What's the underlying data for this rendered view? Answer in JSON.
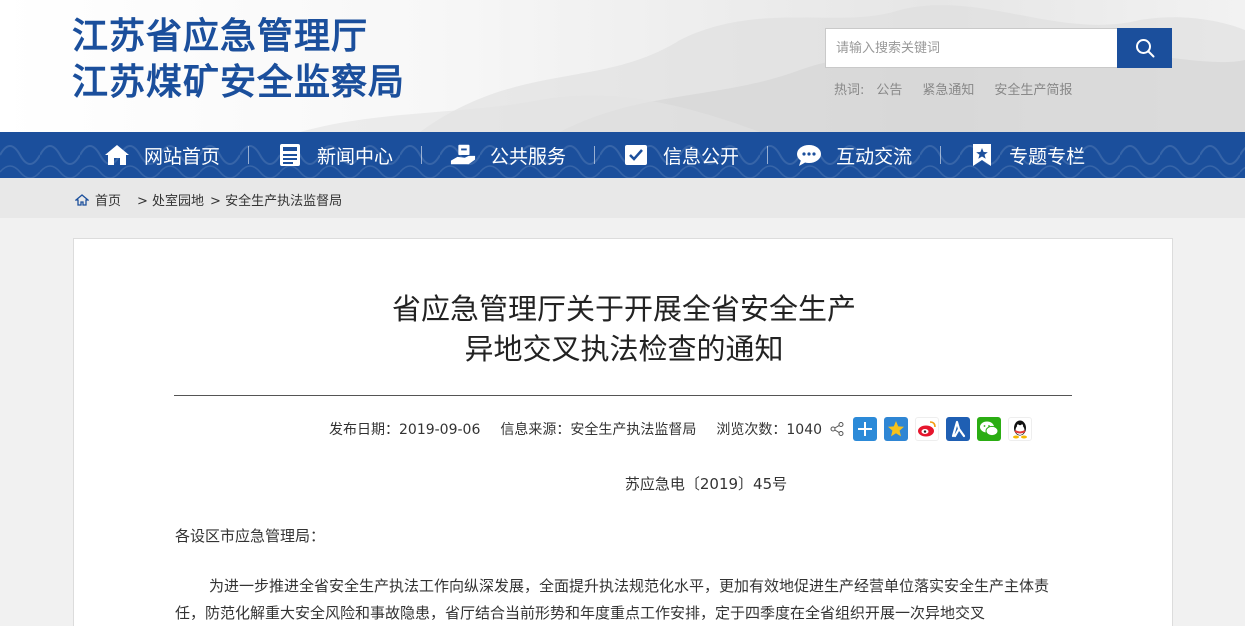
{
  "header": {
    "org_line1": "江苏省应急管理厅",
    "org_line2": "江苏煤矿安全监察局",
    "search_placeholder": "请输入搜索关键词",
    "hot_label": "热词:",
    "hot_words": [
      "公告",
      "紧急通知",
      "安全生产简报"
    ]
  },
  "nav": {
    "items": [
      {
        "label": "网站首页",
        "icon": "home-icon"
      },
      {
        "label": "新闻中心",
        "icon": "news-icon"
      },
      {
        "label": "公共服务",
        "icon": "service-icon"
      },
      {
        "label": "信息公开",
        "icon": "info-icon"
      },
      {
        "label": "互动交流",
        "icon": "chat-icon"
      },
      {
        "label": "专题专栏",
        "icon": "bookmark-icon"
      }
    ]
  },
  "breadcrumb": {
    "home": "首页",
    "items": [
      "> 处室园地",
      "> 安全生产执法监督局"
    ]
  },
  "article": {
    "title_line1": "省应急管理厅关于开展全省安全生产",
    "title_line2": "异地交叉执法检查的通知",
    "date": "发布日期：2019-09-06",
    "source": "信息来源：安全生产执法监督局",
    "views": "浏览次数：1040",
    "share_icons": [
      "more-share-icon",
      "qzone-icon",
      "weibo-icon",
      "renren-icon",
      "wechat-icon",
      "qq-icon"
    ],
    "doc_number": "苏应急电〔2019〕45号",
    "salutation": "各设区市应急管理局：",
    "paragraph": "为进一步推进全省安全生产执法工作向纵深发展，全面提升执法规范化水平，更加有效地促进生产经营单位落实安全生产主体责任，防范化解重大安全风险和事故隐患，省厅结合当前形势和年度重点工作安排，定于四季度在全省组织开展一次异地交叉"
  },
  "colors": {
    "brand_blue": "#1b4f9c"
  }
}
